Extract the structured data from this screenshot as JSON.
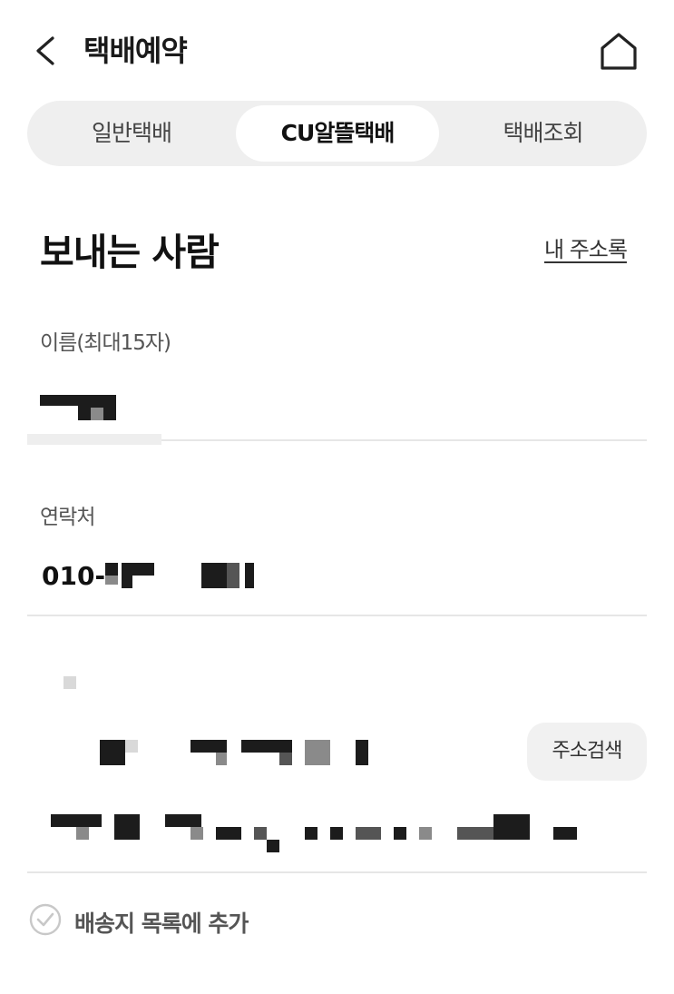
{
  "header": {
    "title": "택배예약",
    "back_icon": "chevron-left-icon",
    "home_icon": "home-icon"
  },
  "tabs": [
    {
      "label": "일반택배",
      "selected": false
    },
    {
      "label": "CU알뜰택배",
      "selected": true
    },
    {
      "label": "택배조회",
      "selected": false
    }
  ],
  "sender": {
    "section_title": "보내는 사람",
    "address_book_link": "내 주소록",
    "name_label": "이름(최대15자)",
    "phone_label": "연락처",
    "phone_value_prefix": "010-",
    "search_address_button": "주소검색",
    "add_to_list_label": "배송지 목록에 추가"
  },
  "colors": {
    "tab_track": "#efefef",
    "selected_tab": "#ffffff",
    "divider": "#e6e6e6",
    "button_bg": "#f1f1f1"
  }
}
